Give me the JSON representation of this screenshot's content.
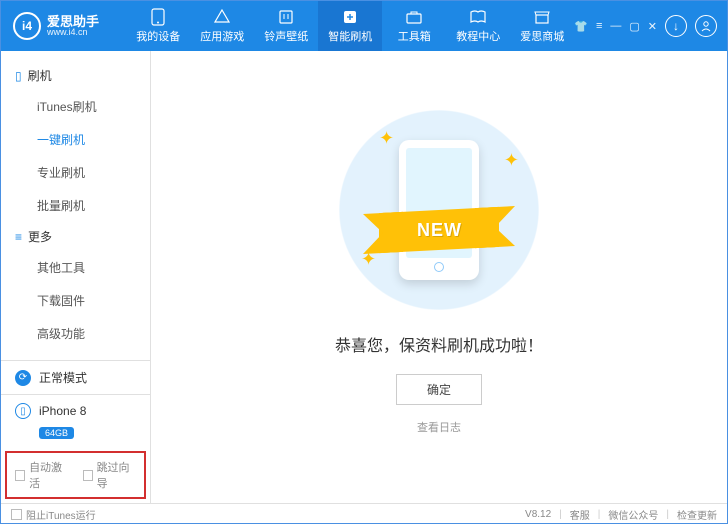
{
  "header": {
    "logo_name": "爱思助手",
    "logo_url": "www.i4.cn",
    "nav": [
      {
        "label": "我的设备",
        "icon": "phone"
      },
      {
        "label": "应用游戏",
        "icon": "apps"
      },
      {
        "label": "铃声壁纸",
        "icon": "music"
      },
      {
        "label": "智能刷机",
        "icon": "flash",
        "active": true
      },
      {
        "label": "工具箱",
        "icon": "tools"
      },
      {
        "label": "教程中心",
        "icon": "book"
      },
      {
        "label": "爱思商城",
        "icon": "store"
      }
    ]
  },
  "sidebar": {
    "groups": [
      {
        "title": "刷机",
        "items": [
          "iTunes刷机",
          "一键刷机",
          "专业刷机",
          "批量刷机"
        ],
        "active_index": 1
      },
      {
        "title": "更多",
        "items": [
          "其他工具",
          "下载固件",
          "高级功能"
        ],
        "active_index": -1
      }
    ],
    "mode": "正常模式",
    "device": {
      "name": "iPhone 8",
      "storage": "64GB"
    },
    "options": [
      "自动激活",
      "跳过向导"
    ]
  },
  "main": {
    "ribbon": "NEW",
    "success": "恭喜您，保资料刷机成功啦！",
    "ok": "确定",
    "log": "查看日志"
  },
  "status": {
    "block_itunes": "阻止iTunes运行",
    "version": "V8.12",
    "links": [
      "客服",
      "微信公众号",
      "检查更新"
    ]
  }
}
